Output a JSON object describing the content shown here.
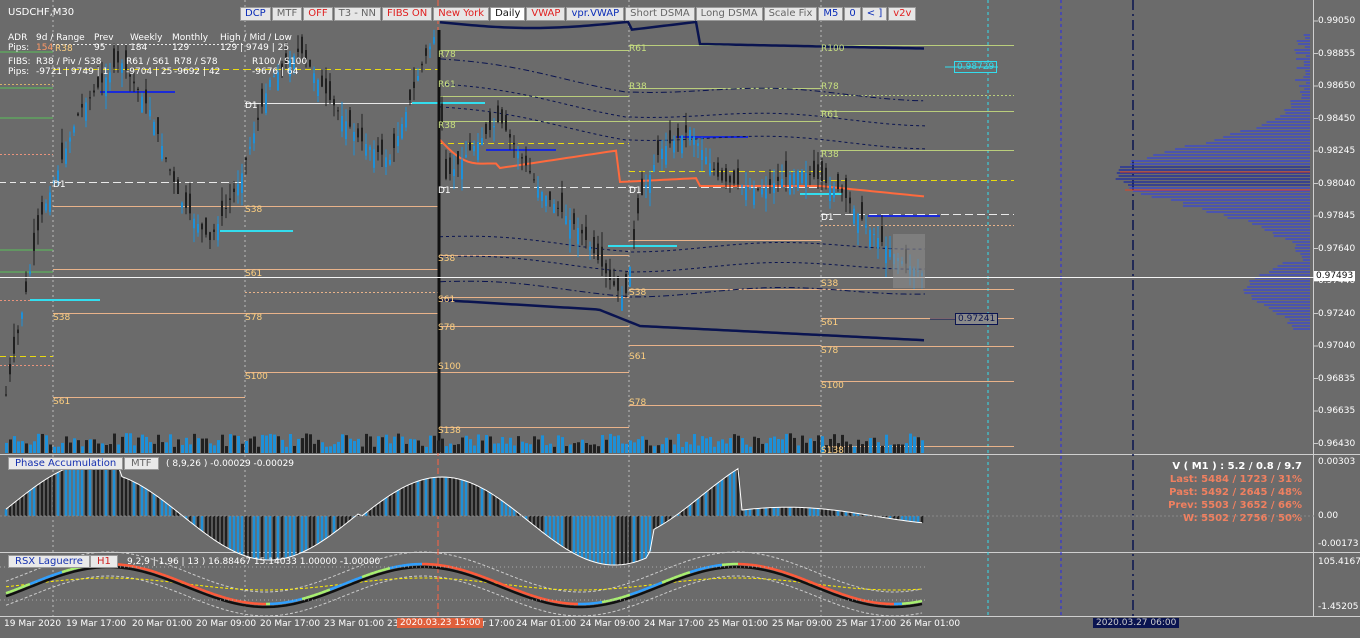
{
  "window": {
    "title": "USDCHF,M30"
  },
  "toolbar": [
    {
      "label": "DCP",
      "style": "blue"
    },
    {
      "label": "MTF",
      "style": "grey"
    },
    {
      "label": "OFF",
      "style": "red"
    },
    {
      "label": "T3 - NN",
      "style": "grey"
    },
    {
      "label": "FIBS ON",
      "style": "red"
    },
    {
      "label": "New York",
      "style": "red"
    },
    {
      "label": "Daily",
      "style": "dark"
    },
    {
      "label": "VWAP",
      "style": "red"
    },
    {
      "label": "vpr.VWAP",
      "style": "blue"
    },
    {
      "label": "Short DSMA",
      "style": "grey"
    },
    {
      "label": "Long DSMA",
      "style": "grey"
    },
    {
      "label": "Scale Fix",
      "style": "grey"
    },
    {
      "label": "M5",
      "style": "blue"
    },
    {
      "label": "0",
      "style": "blue"
    },
    {
      "label": "< ]",
      "style": "blue"
    },
    {
      "label": "v2v",
      "style": "red"
    }
  ],
  "info": {
    "adr_header": [
      "ADR",
      "9d / Range",
      "Prev",
      "Weekly",
      "Monthly",
      "High / Mid / Low"
    ],
    "adr_values": [
      "Pips:",
      "154",
      "95",
      "184",
      "129",
      "129  |  9749  |  25"
    ],
    "fibs_header": [
      "FIBS:",
      "R38 / Piv / S38",
      "R61 / S61",
      "R78 / S78",
      "R100 / S100"
    ],
    "fibs_values": [
      "Pips:",
      "-9721  |  9749  |  1",
      "-9704  |  25",
      "-9692  |  42",
      "-9676  |  64"
    ]
  },
  "price_axis": [
    "0.99050",
    "0.98855",
    "0.98650",
    "0.98450",
    "0.98245",
    "0.98040",
    "0.97845",
    "0.97640",
    "0.97440",
    "0.97240",
    "0.97040",
    "0.96835",
    "0.96635",
    "0.96430"
  ],
  "current_price": "0.97493",
  "price_tag_upper": "0.98729",
  "price_tag_lower": "0.97241",
  "time_axis": [
    "19 Mar 2020",
    "19 Mar 17:00",
    "20 Mar 01:00",
    "20 Mar 09:00",
    "20 Mar 17:00",
    "23 Mar 01:00",
    "23",
    "r 17:00",
    "24 Mar 01:00",
    "24 Mar 09:00",
    "24 Mar 17:00",
    "25 Mar 01:00",
    "25 Mar 09:00",
    "25 Mar 17:00",
    "26 Mar 01:00"
  ],
  "time_marker_red": "2020.03.23 15:00",
  "time_marker_blue": "2020.03.27 06:00",
  "fib_labels": {
    "col1": [
      "R38",
      "D1",
      "S38",
      "S61"
    ],
    "col2": [
      "D1",
      "S38",
      "S61",
      "S78",
      "S100"
    ],
    "col3": [
      "R78",
      "R61",
      "R38",
      "D1",
      "S38",
      "S61",
      "S78",
      "S100",
      "S138"
    ],
    "col4": [
      "R61",
      "R38",
      "D1",
      "S38",
      "S61",
      "S78"
    ],
    "col5": [
      "R100",
      "R78",
      "R61",
      "R38",
      "D1",
      "S38",
      "S61",
      "S78",
      "S100",
      "S138"
    ]
  },
  "panel1": {
    "name": "Phase Accumulation",
    "tag": "MTF",
    "params": "( 8,9,26 ) -0.00029 -0.00029",
    "axis": [
      "0.00303",
      "0.00",
      "-0.00173"
    ],
    "stats": [
      {
        "text": "V ( M1 ) : 5.2 / 0.8 / 9.7",
        "color": "#ffffff"
      },
      {
        "text": "Last: 5484 / 1723 / 31%",
        "color": "#f08060"
      },
      {
        "text": "Past: 5492 / 2645 / 48%",
        "color": "#f08060"
      },
      {
        "text": "Prev: 5503 / 3652 / 66%",
        "color": "#f08060"
      },
      {
        "text": "W: 5502 / 2756 / 50%",
        "color": "#f08060"
      }
    ]
  },
  "panel2": {
    "name": "RSX Laguerre",
    "tag": "H1",
    "params": "9,2,9  |  1.96  |  13 )  16.88467 15.14033 1.00000 -1.00000",
    "axis": [
      "105.41671",
      "-1.45205"
    ]
  },
  "colors": {
    "background": "#6b6b6b",
    "up_bar": "#1e90d8",
    "down_bar": "#202020",
    "vwap": "#ff6a3d",
    "band": "#0a1450",
    "cyan": "#33ddee"
  }
}
